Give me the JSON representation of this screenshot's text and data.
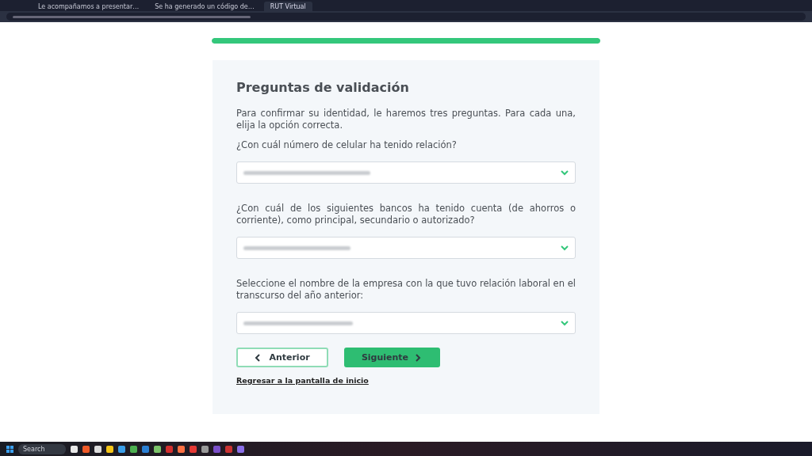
{
  "browser": {
    "tabs": [
      {
        "title": "Le acompañamos a presentar…",
        "selected": false
      },
      {
        "title": "Se ha generado un código de…",
        "selected": false
      },
      {
        "title": "RUT Virtual",
        "selected": true
      }
    ]
  },
  "progress": {
    "level": 1
  },
  "form": {
    "title": "Preguntas de validación",
    "intro": "Para confirmar su identidad, le haremos tres preguntas. Para cada una, elija la opción correcta.",
    "questions": [
      {
        "label": "¿Con cuál número de celular ha tenido relación?"
      },
      {
        "label": "¿Con cuál de los siguientes bancos ha tenido cuenta (de ahorros o corriente), como principal, secundario o autorizado?"
      },
      {
        "label": "Seleccione el nombre de la empresa con la que tuvo relación laboral en el transcurso del año anterior:"
      }
    ],
    "buttons": [
      {
        "label": "Anterior",
        "kind": "back"
      },
      {
        "label": "Siguiente",
        "kind": "next"
      }
    ],
    "link": "Regresar a la pantalla de inicio"
  },
  "taskbar": {
    "search": "Search"
  }
}
